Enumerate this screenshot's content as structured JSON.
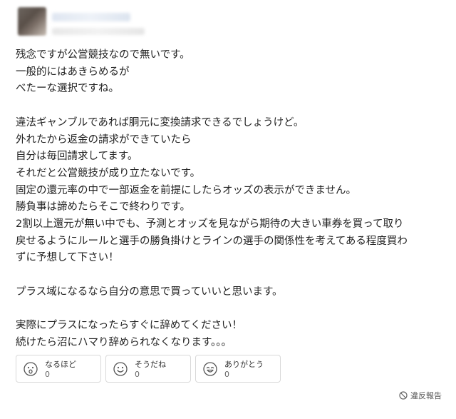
{
  "answer": {
    "lines": [
      "残念ですが公営競技なので無いです。",
      "一般的にはあきらめるが",
      "べたーな選択ですね。",
      "",
      "違法ギャンブルであれば胴元に変換請求できるでしょうけど。",
      "外れたから返金の請求ができていたら",
      "自分は毎回請求してます。",
      "それだと公営競技が成り立たないです。",
      "固定の還元率の中で一部返金を前提にしたらオッズの表示ができません。",
      "勝負事は諦めたらそこで終わりです。",
      "2割以上還元が無い中でも、予測とオッズを見ながら期待の大きい車券を買って取り",
      "戻せるようにルールと選手の勝負掛けとラインの選手の関係性を考えてある程度買わ",
      "ずに予想して下さい！",
      "",
      "プラス域になるなら自分の意思で買っていいと思います。",
      "",
      "実際にプラスになったらすぐに辞めてください！",
      "続けたら沼にハマり辞められなくなります。。。"
    ]
  },
  "reactions": [
    {
      "label": "なるほど",
      "count": "0",
      "icon": "surprised-face-icon"
    },
    {
      "label": "そうだね",
      "count": "0",
      "icon": "smile-face-icon"
    },
    {
      "label": "ありがとう",
      "count": "0",
      "icon": "grin-face-icon"
    }
  ],
  "report": {
    "label": "違反報告",
    "icon": "prohibited-icon"
  },
  "colors": {
    "border": "#d9d9d9",
    "text": "#222222",
    "muted": "#666666"
  }
}
